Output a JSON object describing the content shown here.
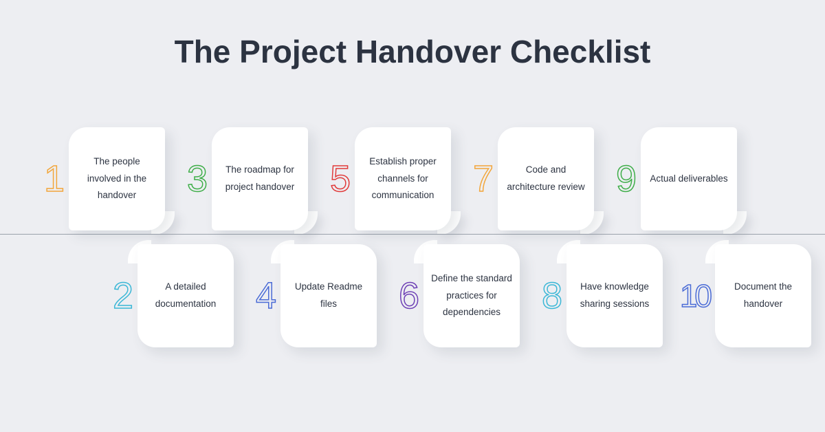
{
  "title": "The Project Handover Checklist",
  "items": [
    {
      "n": "1",
      "text": "The people involved in the handover",
      "color": "#f2a63b"
    },
    {
      "n": "2",
      "text": "A detailed documentation",
      "color": "#3bb7d6"
    },
    {
      "n": "3",
      "text": "The roadmap for project handover",
      "color": "#3fae49"
    },
    {
      "n": "4",
      "text": "Update Readme files",
      "color": "#4a6bd6"
    },
    {
      "n": "5",
      "text": "Establish proper channels for communication",
      "color": "#e13a3a"
    },
    {
      "n": "6",
      "text": "Define the standard practices for dependencies",
      "color": "#6d3fb5"
    },
    {
      "n": "7",
      "text": "Code and architecture review",
      "color": "#f2a63b"
    },
    {
      "n": "8",
      "text": "Have knowledge sharing sessions",
      "color": "#3bb7d6"
    },
    {
      "n": "9",
      "text": "Actual deliverables",
      "color": "#3fae49"
    },
    {
      "n": "10",
      "text": "Document the handover",
      "color": "#4a6bd6"
    }
  ]
}
